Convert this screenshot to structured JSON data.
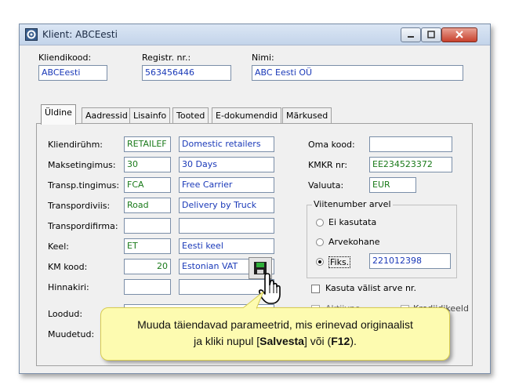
{
  "window": {
    "title": "Klient: ABCEesti"
  },
  "header": {
    "kliendikood_label": "Kliendikood:",
    "kliendikood_value": "ABCEesti",
    "registr_label": "Registr. nr.:",
    "registr_value": "563456446",
    "nimi_label": "Nimi:",
    "nimi_value": "ABC Eesti OÜ"
  },
  "tabs": [
    {
      "label": "Üldine"
    },
    {
      "label": "Aadressid"
    },
    {
      "label": "Lisainfo"
    },
    {
      "label": "Tooted"
    },
    {
      "label": "E-dokumendid"
    },
    {
      "label": "Märkused"
    }
  ],
  "form": {
    "kliendiruhm_label": "Kliendirühm:",
    "kliendiruhm_code": "RETAILEF",
    "kliendiruhm_name": "Domestic retailers",
    "maksetingimus_label": "Maksetingimus:",
    "maksetingimus_code": "30",
    "maksetingimus_name": "30 Days",
    "transp_label": "Transp.tingimus:",
    "transp_code": "FCA",
    "transp_name": "Free Carrier",
    "transpordiviis_label": "Transpordiviis:",
    "transpordiviis_code": "Road",
    "transpordiviis_name": "Delivery by Truck",
    "transpordifirma_label": "Transpordifirma:",
    "keel_label": "Keel:",
    "keel_code": "ET",
    "keel_name": "Eesti keel",
    "km_label": "KM kood:",
    "km_code": "20",
    "km_name": "Estonian VAT",
    "hinnakiri_label": "Hinnakiri:",
    "loodud_label": "Loodud:",
    "muudetud_label": "Muudetud:"
  },
  "right": {
    "oma_kood_label": "Oma kood:",
    "kmkr_label": "KMKR nr:",
    "kmkr_value": "EE234523372",
    "valuuta_label": "Valuuta:",
    "valuuta_value": "EUR",
    "viitenumber_title": "Viitenumber arvel",
    "ei_kasutata": "Ei kasutata",
    "arvekohane": "Arvekohane",
    "fiks": "Fiks.",
    "fiks_value": "221012398",
    "kasuta_valist": "Kasuta välist arve nr.",
    "aktiivne": "Aktiivne",
    "krediidikeeld": "Krediidikeeld"
  },
  "callout": {
    "line1": "Muuda täiendavad parameetrid, mis erinevad originaalist",
    "line2_prefix": "ja kliki nupul  [",
    "save_word": "Salvesta",
    "line2_mid": "] või (",
    "key": "F12",
    "line2_suffix": ")."
  },
  "colors": {
    "field_text": "#1a39b8",
    "callout_bg": "#fdfbb0",
    "accent_green": "#1a7a1a"
  }
}
